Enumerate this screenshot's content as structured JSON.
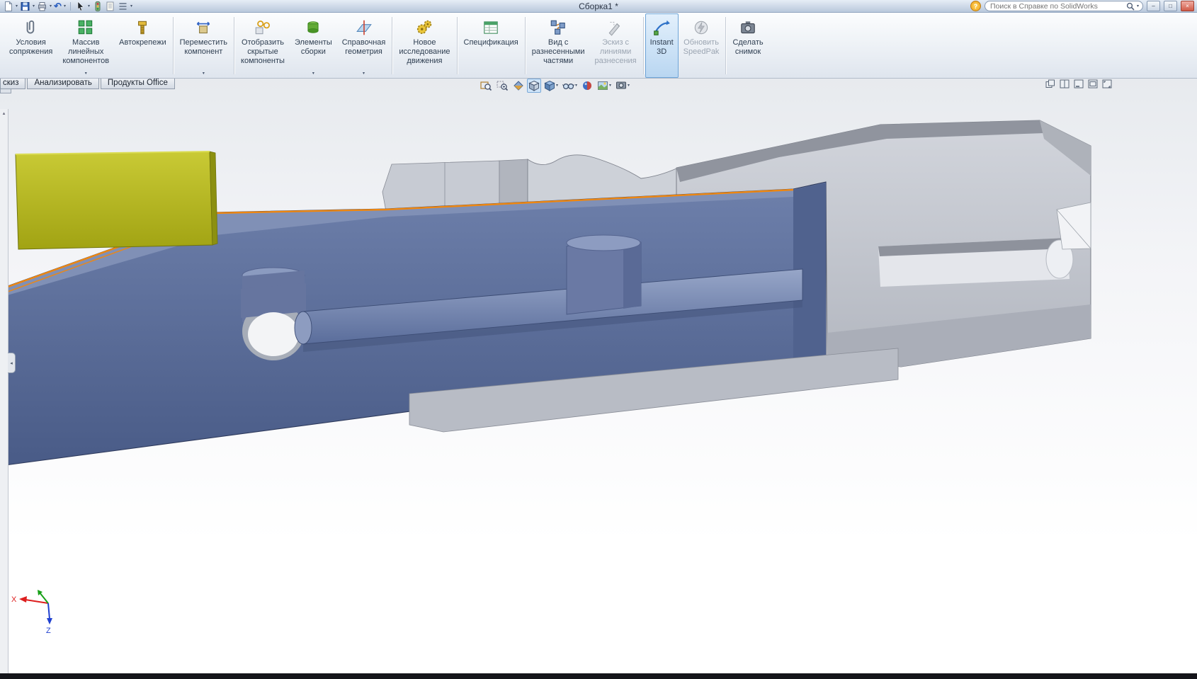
{
  "titlebar": {
    "title": "Сборка1 *",
    "search_placeholder": "Поиск в Справке по SolidWorks"
  },
  "glyphs": {
    "caret": "▾",
    "expand": "»",
    "scroll_up": "▴",
    "collapse_left": "◂",
    "undo": "↶",
    "help": "?",
    "minimize": "–",
    "maximize": "□",
    "close": "×"
  },
  "ribbon": {
    "buttons": [
      {
        "label": "Условия\nсопряжения",
        "dropdown": false,
        "state": "normal"
      },
      {
        "label": "Массив\nлинейных\nкомпонентов",
        "dropdown": true,
        "state": "normal"
      },
      {
        "label": "Автокрепежи",
        "dropdown": false,
        "state": "normal"
      },
      {
        "label": "Переместить\nкомпонент",
        "dropdown": true,
        "state": "normal"
      },
      {
        "label": "Отобразить\nскрытые\nкомпоненты",
        "dropdown": false,
        "state": "normal"
      },
      {
        "label": "Элементы\nсборки",
        "dropdown": true,
        "state": "normal"
      },
      {
        "label": "Справочная\nгеометрия",
        "dropdown": true,
        "state": "normal"
      },
      {
        "label": "Новое\nисследование\nдвижения",
        "dropdown": false,
        "state": "normal"
      },
      {
        "label": "Спецификация",
        "dropdown": false,
        "state": "normal"
      },
      {
        "label": "Вид с\nразнесенными\nчастями",
        "dropdown": false,
        "state": "normal"
      },
      {
        "label": "Эскиз с\nлиниями\nразнесения",
        "dropdown": false,
        "state": "disabled"
      },
      {
        "label": "Instant\n3D",
        "dropdown": false,
        "state": "active"
      },
      {
        "label": "Обновить\nSpeedPak",
        "dropdown": false,
        "state": "disabled"
      },
      {
        "label": "Сделать\nснимок",
        "dropdown": false,
        "state": "normal"
      }
    ]
  },
  "tabs": {
    "items": [
      {
        "label": "скиз"
      },
      {
        "label": "Анализировать"
      },
      {
        "label": "Продукты Office"
      }
    ]
  },
  "headsup": {
    "tools": [
      "zoom-fit",
      "zoom-area",
      "section-view",
      "view-orientation",
      "display-style",
      "hide-show-items",
      "edit-appearance",
      "apply-scene",
      "view-settings"
    ]
  },
  "doc_controls": [
    "window-cascade",
    "window-tile",
    "window-minimize",
    "window-restore",
    "fullscreen"
  ],
  "viewport": {
    "triad": {
      "x_label": "X",
      "z_label": "Z"
    }
  },
  "model": {
    "document": "Сборка1",
    "parts": [
      "yellow-slide-block",
      "blue-carrier-body",
      "piston-rod",
      "vertical-boss",
      "bolt-hole",
      "gray-receiver"
    ],
    "selection_highlight": "#ee8711",
    "body_blue": "#5f73a1",
    "part_yellow": "#b9ba25",
    "part_gray": "#c6c9d1"
  }
}
